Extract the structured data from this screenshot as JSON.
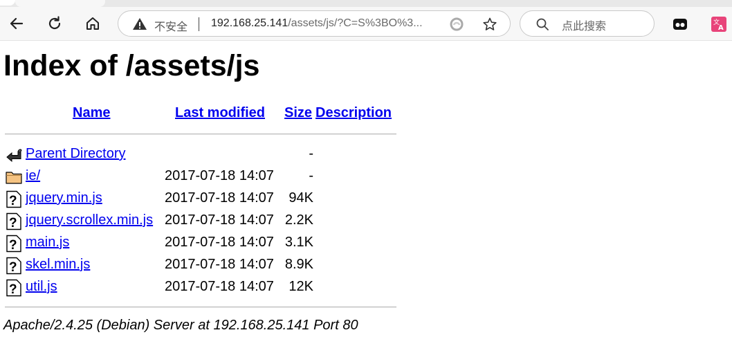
{
  "browser": {
    "insecure_label": "不安全",
    "url_host": "192.168.25.141",
    "url_path": "/assets/js/?C=S%3BO%3...",
    "search_placeholder": "点此搜索"
  },
  "page": {
    "title": "Index of /assets/js",
    "columns": {
      "name": "Name",
      "last_modified": "Last modified",
      "size": "Size",
      "description": "Description"
    },
    "rows": [
      {
        "icon": "back-icon",
        "name": "Parent Directory",
        "date": "",
        "size": "-",
        "desc": ""
      },
      {
        "icon": "folder-icon",
        "name": "ie/",
        "date": "2017-07-18 14:07",
        "size": "-",
        "desc": ""
      },
      {
        "icon": "unknown-file-icon",
        "name": "jquery.min.js",
        "date": "2017-07-18 14:07",
        "size": "94K",
        "desc": ""
      },
      {
        "icon": "unknown-file-icon",
        "name": "jquery.scrollex.min.js",
        "date": "2017-07-18 14:07",
        "size": "2.2K",
        "desc": ""
      },
      {
        "icon": "unknown-file-icon",
        "name": "main.js",
        "date": "2017-07-18 14:07",
        "size": "3.1K",
        "desc": ""
      },
      {
        "icon": "unknown-file-icon",
        "name": "skel.min.js",
        "date": "2017-07-18 14:07",
        "size": "8.9K",
        "desc": ""
      },
      {
        "icon": "unknown-file-icon",
        "name": "util.js",
        "date": "2017-07-18 14:07",
        "size": "12K",
        "desc": ""
      }
    ],
    "footer": "Apache/2.4.25 (Debian) Server at 192.168.25.141 Port 80"
  },
  "colors": {
    "link": "#0000ee",
    "chrome_bg": "#f7f7f7"
  }
}
